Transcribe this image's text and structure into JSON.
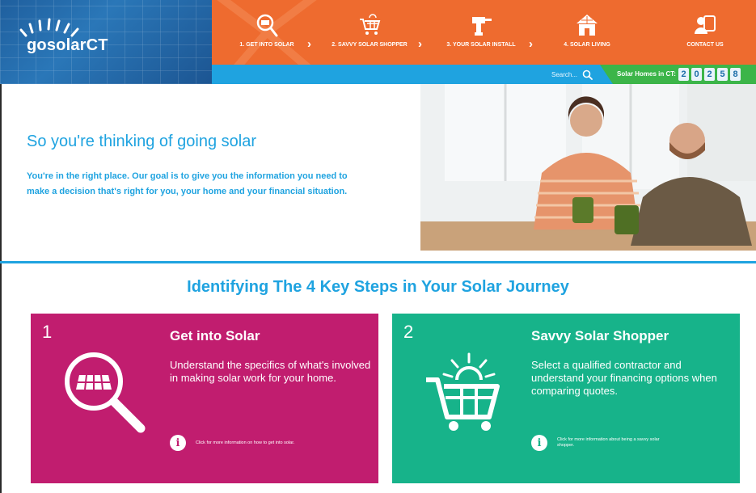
{
  "brand": {
    "logo_main": "gosolar",
    "logo_ct": "CT"
  },
  "nav": {
    "items": [
      {
        "label": "1. GET INTO SOLAR",
        "icon": "magnifier-solar-icon"
      },
      {
        "label": "2. SAVVY SOLAR SHOPPER",
        "icon": "cart-icon"
      },
      {
        "label": "3. YOUR SOLAR INSTALL",
        "icon": "drill-icon"
      },
      {
        "label": "4. SOLAR LIVING",
        "icon": "house-icon"
      },
      {
        "label": "CONTACT US",
        "icon": "contact-icon"
      }
    ],
    "separator": "›"
  },
  "search": {
    "placeholder": "Search..."
  },
  "counter": {
    "label": "Solar Homes in CT:",
    "digits": [
      "2",
      "0",
      "2",
      "5",
      "8"
    ]
  },
  "hero": {
    "title": "So you're thinking of going solar",
    "text": "You're in the right place. Our goal is to give you the information you need to make a decision that's right for you, your home and your financial situation."
  },
  "section": {
    "title": "Identifying The 4 Key Steps in Your Solar Journey"
  },
  "cards": [
    {
      "number": "1",
      "title": "Get into Solar",
      "desc": "Understand the specifics of what's involved in making solar work for your home.",
      "more": "Click for more information on how to get into solar.",
      "color": "#c11d6f"
    },
    {
      "number": "2",
      "title": "Savvy Solar Shopper",
      "desc": "Select a qualified contractor and understand your financing options when comparing quotes.",
      "more": "Click for more information about being a savvy solar shopper.",
      "color": "#17b38a"
    }
  ],
  "colors": {
    "orange": "#ee6b2f",
    "blue": "#1fa3e0",
    "green": "#3cb549"
  }
}
